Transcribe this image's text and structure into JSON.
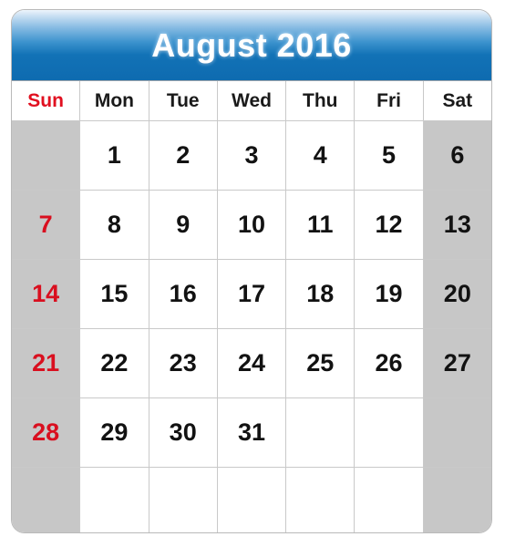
{
  "calendar": {
    "title": "August 2016",
    "month": "August",
    "year": "2016",
    "accent_header_color": "#0e6bb0",
    "sunday_text_color": "#e11020",
    "weekend_cell_color": "#c7c7c7",
    "grid_line_color": "#c9c9c9",
    "weekday_headers": [
      {
        "label": "Sun",
        "kind": "sunday"
      },
      {
        "label": "Mon",
        "kind": "weekday"
      },
      {
        "label": "Tue",
        "kind": "weekday"
      },
      {
        "label": "Wed",
        "kind": "weekday"
      },
      {
        "label": "Thu",
        "kind": "weekday"
      },
      {
        "label": "Fri",
        "kind": "weekday"
      },
      {
        "label": "Sat",
        "kind": "saturday"
      }
    ],
    "weeks": [
      [
        {
          "day": "",
          "kind": "sunday"
        },
        {
          "day": "1",
          "kind": "weekday"
        },
        {
          "day": "2",
          "kind": "weekday"
        },
        {
          "day": "3",
          "kind": "weekday"
        },
        {
          "day": "4",
          "kind": "weekday"
        },
        {
          "day": "5",
          "kind": "weekday"
        },
        {
          "day": "6",
          "kind": "saturday"
        }
      ],
      [
        {
          "day": "7",
          "kind": "sunday"
        },
        {
          "day": "8",
          "kind": "weekday"
        },
        {
          "day": "9",
          "kind": "weekday"
        },
        {
          "day": "10",
          "kind": "weekday"
        },
        {
          "day": "11",
          "kind": "weekday"
        },
        {
          "day": "12",
          "kind": "weekday"
        },
        {
          "day": "13",
          "kind": "saturday"
        }
      ],
      [
        {
          "day": "14",
          "kind": "sunday"
        },
        {
          "day": "15",
          "kind": "weekday"
        },
        {
          "day": "16",
          "kind": "weekday"
        },
        {
          "day": "17",
          "kind": "weekday"
        },
        {
          "day": "18",
          "kind": "weekday"
        },
        {
          "day": "19",
          "kind": "weekday"
        },
        {
          "day": "20",
          "kind": "saturday"
        }
      ],
      [
        {
          "day": "21",
          "kind": "sunday"
        },
        {
          "day": "22",
          "kind": "weekday"
        },
        {
          "day": "23",
          "kind": "weekday"
        },
        {
          "day": "24",
          "kind": "weekday"
        },
        {
          "day": "25",
          "kind": "weekday"
        },
        {
          "day": "26",
          "kind": "weekday"
        },
        {
          "day": "27",
          "kind": "saturday"
        }
      ],
      [
        {
          "day": "28",
          "kind": "sunday"
        },
        {
          "day": "29",
          "kind": "weekday"
        },
        {
          "day": "30",
          "kind": "weekday"
        },
        {
          "day": "31",
          "kind": "weekday"
        },
        {
          "day": "",
          "kind": "weekday"
        },
        {
          "day": "",
          "kind": "weekday"
        },
        {
          "day": "",
          "kind": "saturday"
        }
      ],
      [
        {
          "day": "",
          "kind": "sunday"
        },
        {
          "day": "",
          "kind": "weekday"
        },
        {
          "day": "",
          "kind": "weekday"
        },
        {
          "day": "",
          "kind": "weekday"
        },
        {
          "day": "",
          "kind": "weekday"
        },
        {
          "day": "",
          "kind": "weekday"
        },
        {
          "day": "",
          "kind": "saturday"
        }
      ]
    ]
  }
}
